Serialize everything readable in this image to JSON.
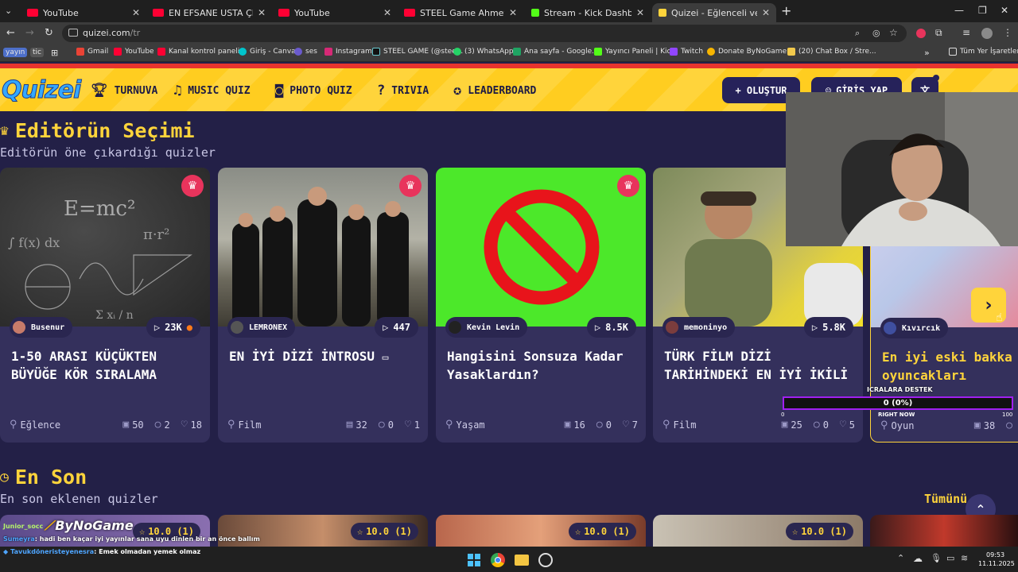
{
  "browser": {
    "tabs": [
      {
        "title": "YouTube",
        "color": "#ff0033"
      },
      {
        "title": "EN EFSANE USTA ÇIRAK - YouTub",
        "color": "#ff0033"
      },
      {
        "title": "YouTube",
        "color": "#ff0033"
      },
      {
        "title": "STEEL Game Ahmet Çelik - YouTu",
        "color": "#ff0033"
      },
      {
        "title": "Stream - Kick Dashboard",
        "color": "#53fc18"
      },
      {
        "title": "Quizei - Eğlenceli ve etkileşimli",
        "color": "#ffd43b"
      }
    ],
    "url_host": "quizei.com",
    "url_path": "/tr",
    "bookmarks": [
      {
        "label": "yayın"
      },
      {
        "label": "tic"
      },
      {
        "label": "Gmail"
      },
      {
        "label": "YouTube"
      },
      {
        "label": "Kanal kontrol paneli..."
      },
      {
        "label": "Giriş - Canva"
      },
      {
        "label": "ses"
      },
      {
        "label": "Instagram"
      },
      {
        "label": "STEEL GAME (@stee..."
      },
      {
        "label": "(3) WhatsApp"
      },
      {
        "label": "Ana sayfa - Google..."
      },
      {
        "label": "Yayıncı Paneli | Kick"
      },
      {
        "label": "Twitch"
      },
      {
        "label": "Donate ByNoGame..."
      },
      {
        "label": "(20) Chat Box / Stre..."
      },
      {
        "label": "Tüm Yer İşaretleri"
      }
    ]
  },
  "site": {
    "logo": "Quizei",
    "nav": [
      "TURNUVA",
      "MUSIC QUIZ",
      "PHOTO QUIZ",
      "TRIVIA",
      "LEADERBOARD"
    ],
    "create_label": "+ OLUŞTUR",
    "login_label": "GİRİŞ YAP"
  },
  "editors": {
    "title": "Editörün Seçimi",
    "subtitle": "Editörün öne çıkardığı quizler",
    "cards": [
      {
        "author": "Busenur",
        "plays": "23K",
        "title": "1-50 ARASI KÜÇÜKTEN BÜYÜĞE KÖR SIRALAMA",
        "category": "Eğlence",
        "images": "50",
        "comments": "2",
        "likes": "18"
      },
      {
        "author": "LEMRONEX",
        "plays": "447",
        "title": "EN İYİ DİZİ İNTROSU",
        "category": "Film",
        "images": "32",
        "comments": "0",
        "likes": "1"
      },
      {
        "author": "Kevin Levin",
        "plays": "8.5K",
        "title": "Hangisini Sonsuza Kadar Yasaklardın?",
        "category": "Yaşam",
        "images": "16",
        "comments": "0",
        "likes": "7"
      },
      {
        "author": "memoninyo",
        "plays": "5.8K",
        "title": "TÜRK FİLM DİZİ TARİHİNDEKİ EN İYİ İKİLİ",
        "category": "Film",
        "images": "25",
        "comments": "0",
        "likes": "5"
      },
      {
        "author": "Kıvırcık",
        "plays": "",
        "title": "En iyi eski bakka oyuncakları",
        "category": "Oyun",
        "images": "38",
        "comments": "",
        "likes": ""
      }
    ]
  },
  "latest": {
    "title": "En Son",
    "subtitle": "En son eklenen quizler",
    "see_all": "Tümünü",
    "ratings": [
      "10.0 (1)",
      "10.0 (1)",
      "10.0 (1)",
      "10.0 (1)"
    ]
  },
  "overlay": {
    "donation_title": "ICRALARA DESTEK",
    "donation_value": "0 (0%)",
    "donation_min": "0",
    "donation_max": "100",
    "donation_progress": 0,
    "right_now": "RIGHT NOW",
    "chat_logo": "ByNoGame",
    "chat": [
      {
        "user": "Junior_socc",
        "msg": ""
      },
      {
        "user": "Sumeyra",
        "msg": ": hadi ben kaçar iyi yayınlar sana uyu dinlen bir an önce ballım"
      },
      {
        "user": "Tavukdöneristeyenesra",
        "msg": ": Emek olmadan yemek olmaz"
      }
    ]
  },
  "taskbar": {
    "time": "09:53",
    "date": "11.11.2025"
  }
}
